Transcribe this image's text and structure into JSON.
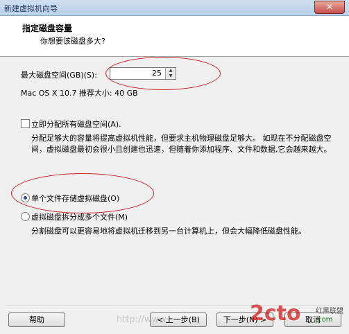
{
  "window": {
    "title": "新建虚拟机向导",
    "close_glyph": "✕"
  },
  "header": {
    "title": "指定磁盘容量",
    "subtitle": "你想要该磁盘多大?"
  },
  "disk_size": {
    "label": "最大磁盘空间(GB)(S):",
    "value": "25",
    "recommendation": "Mac OS X 10.7 推荐大小: 40 GB"
  },
  "allocate": {
    "checkbox_label": "立即分配所有磁盘空间(A).",
    "checked": false,
    "description": "分配足够大的容量将提高虚拟机性能，但要求主机物理磁盘足够大。 如现在不分配磁盘空间，虚拟磁盘最初会很小且创建也迅速，但随着你添加程序、文件和数据,它会越来越大。"
  },
  "storage_options": {
    "single_file_label": "单个文件存储虚拟磁盘(O)",
    "single_file_selected": true,
    "split_files_label": "虚拟磁盘拆分成多个文件(M)",
    "split_files_selected": false,
    "split_description": "分割磁盘可以更容易地将虚拟机迁移到另一台计算机上，但会大幅降低磁盘性能。"
  },
  "footer": {
    "help_label": "帮助",
    "back_label": "< 上一步(B)",
    "next_label": "下一步(N) >",
    "cancel_label": "取消"
  },
  "overlay": {
    "watermark": "http://www.",
    "logo_text": "2cto",
    "logo_side1": "红黑联盟",
    "logo_side2": ".com",
    "annotation_color": "#cc2020"
  }
}
